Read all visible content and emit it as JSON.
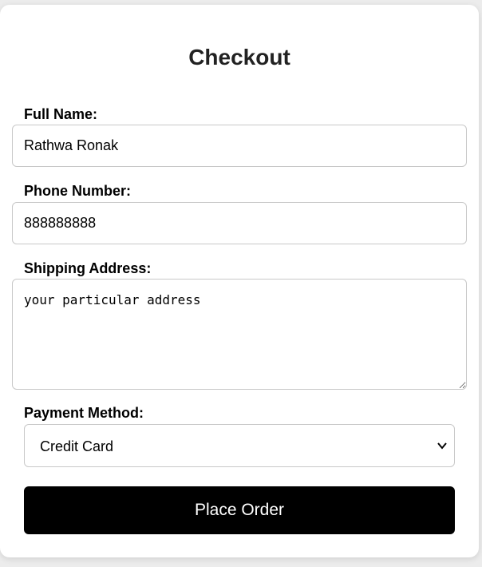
{
  "form": {
    "title": "Checkout",
    "full_name": {
      "label": "Full Name:",
      "value": "Rathwa Ronak"
    },
    "phone": {
      "label": "Phone Number:",
      "value": "888888888"
    },
    "address": {
      "label": "Shipping Address:",
      "value": "your particular address"
    },
    "payment": {
      "label": "Payment Method:",
      "selected": "Credit Card"
    },
    "submit_label": "Place Order"
  },
  "icons": {
    "select_arrow": "chevron-down-icon"
  },
  "colors": {
    "button_bg": "#000000",
    "button_text": "#ffffff",
    "page_bg": "#ececec",
    "border": "#c8c8c8"
  }
}
